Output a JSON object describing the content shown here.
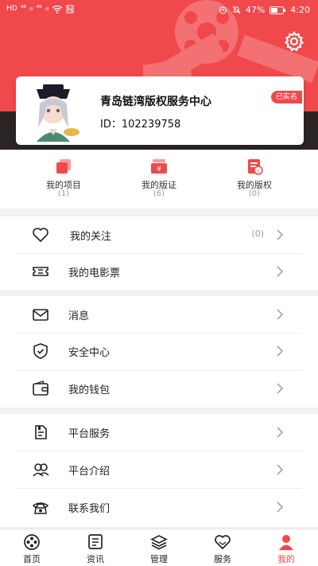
{
  "status_bar": {
    "left_chips": [
      "HD",
      "⁴⁶",
      "ᵢₗₗ",
      "⁴⁶",
      "ᵢₗₗ"
    ],
    "battery": "47%",
    "time": "4:20"
  },
  "profile": {
    "company_name": "青岛链湾版权服务中心",
    "id_text": "ID：102239758",
    "verified_label": "已实名"
  },
  "stats": [
    {
      "label": "我的项目",
      "count": "(1)",
      "icon": "project-icon"
    },
    {
      "label": "我的版证",
      "count": "(6)",
      "icon": "certificate-icon"
    },
    {
      "label": "我的版权",
      "count": "(0)",
      "icon": "copyright-icon"
    }
  ],
  "menu_groups": [
    [
      {
        "label": "我的关注",
        "count": "(0)",
        "icon": "heart-icon"
      },
      {
        "label": "我的电影票",
        "count": "",
        "icon": "ticket-icon"
      }
    ],
    [
      {
        "label": "消息",
        "count": "",
        "icon": "mail-icon"
      },
      {
        "label": "安全中心",
        "count": "",
        "icon": "shield-icon"
      },
      {
        "label": "我的钱包",
        "count": "",
        "icon": "wallet-icon"
      }
    ],
    [
      {
        "label": "平台服务",
        "count": "",
        "icon": "service-icon"
      },
      {
        "label": "平台介绍",
        "count": "",
        "icon": "people-icon"
      },
      {
        "label": "联系我们",
        "count": "",
        "icon": "phone-icon"
      }
    ]
  ],
  "tabs": [
    {
      "label": "首页",
      "icon": "film-reel-icon",
      "active": false
    },
    {
      "label": "资讯",
      "icon": "news-icon",
      "active": false
    },
    {
      "label": "管理",
      "icon": "layers-icon",
      "active": false
    },
    {
      "label": "服务",
      "icon": "heart-hands-icon",
      "active": false
    },
    {
      "label": "我的",
      "icon": "person-icon",
      "active": true
    }
  ],
  "colors": {
    "accent": "#f0484b",
    "dark_band": "#2b2424"
  }
}
